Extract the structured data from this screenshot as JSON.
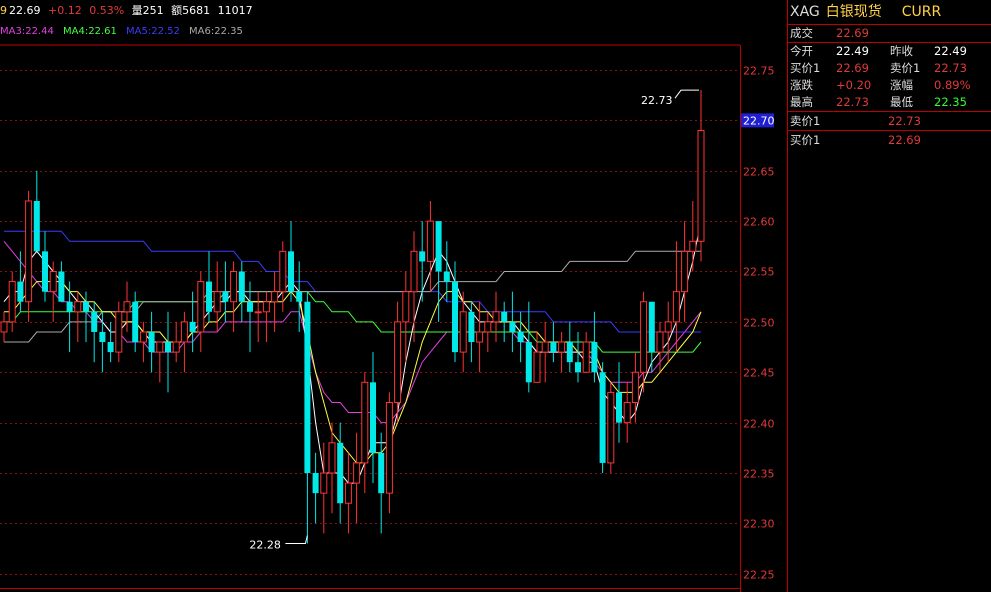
{
  "header": {
    "last_prefix": "9",
    "last_price": "22.69",
    "change": "+0.12",
    "change_pct": "0.53%",
    "volume_label": "量251",
    "amount_label": "额5681",
    "time": "11017"
  },
  "ma_legend": [
    {
      "label": "MA3:22.44",
      "color": "#e040e0"
    },
    {
      "label": "MA4:22.61",
      "color": "#40ff40"
    },
    {
      "label": "MA5:22.52",
      "color": "#3a3aff"
    },
    {
      "label": "MA6:22.35",
      "color": "#aaaaaa"
    }
  ],
  "panel": {
    "code": "XAG",
    "name": "白银现货",
    "currency": "CURR",
    "rows": [
      {
        "label": "成交",
        "value": "22.69",
        "color": "#e03a3a"
      },
      {
        "label": "今开",
        "value": "22.49",
        "color": "#ffffff",
        "label2": "昨收",
        "value2": "22.49",
        "color2": "#ffffff"
      },
      {
        "label": "买价1",
        "value": "22.69",
        "color": "#e03a3a",
        "label2": "卖价1",
        "value2": "22.73",
        "color2": "#e03a3a"
      },
      {
        "label": "涨跌",
        "value": "+0.20",
        "color": "#e03a3a",
        "label2": "涨幅",
        "value2": "0.89%",
        "color2": "#e03a3a"
      },
      {
        "label": "最高",
        "value": "22.73",
        "color": "#e03a3a",
        "label2": "最低",
        "value2": "22.35",
        "color2": "#30ff30"
      }
    ],
    "ask": {
      "label": "卖价1",
      "value": "22.73"
    },
    "bid": {
      "label": "买价1",
      "value": "22.69"
    }
  },
  "chart_data": {
    "type": "candlestick",
    "y_ticks": [
      "22.75",
      "22.70",
      "22.65",
      "22.60",
      "22.55",
      "22.50",
      "22.45",
      "22.40",
      "22.35",
      "22.30",
      "22.25"
    ],
    "ylim": [
      22.23,
      22.79
    ],
    "current_price_label": "22.70",
    "current_price": 22.7,
    "high_annotation": {
      "label": "22.73",
      "value": 22.73,
      "candle_index": 85
    },
    "low_annotation": {
      "label": "22.28",
      "value": 22.28,
      "candle_index": 37
    },
    "colors": {
      "up": "#ff3333",
      "down": "#00e8e8",
      "grid": "#8a1010",
      "axis": "#c00000"
    },
    "ohlc": [
      [
        22.49,
        22.51,
        22.48,
        22.5
      ],
      [
        22.5,
        22.55,
        22.49,
        22.54
      ],
      [
        22.54,
        22.57,
        22.51,
        22.52
      ],
      [
        22.52,
        22.63,
        22.5,
        22.62
      ],
      [
        22.62,
        22.65,
        22.58,
        22.57
      ],
      [
        22.57,
        22.59,
        22.52,
        22.53
      ],
      [
        22.53,
        22.56,
        22.5,
        22.55
      ],
      [
        22.55,
        22.56,
        22.52,
        22.52
      ],
      [
        22.52,
        22.54,
        22.47,
        22.51
      ],
      [
        22.51,
        22.53,
        22.48,
        22.52
      ],
      [
        22.52,
        22.53,
        22.48,
        22.51
      ],
      [
        22.51,
        22.52,
        22.46,
        22.49
      ],
      [
        22.49,
        22.51,
        22.45,
        22.48
      ],
      [
        22.48,
        22.5,
        22.46,
        22.47
      ],
      [
        22.47,
        22.52,
        22.46,
        22.51
      ],
      [
        22.51,
        22.54,
        22.49,
        22.52
      ],
      [
        22.52,
        22.53,
        22.47,
        22.48
      ],
      [
        22.48,
        22.5,
        22.46,
        22.49
      ],
      [
        22.49,
        22.51,
        22.45,
        22.47
      ],
      [
        22.47,
        22.48,
        22.44,
        22.48
      ],
      [
        22.48,
        22.51,
        22.43,
        22.47
      ],
      [
        22.47,
        22.5,
        22.46,
        22.48
      ],
      [
        22.48,
        22.51,
        22.45,
        22.5
      ],
      [
        22.5,
        22.53,
        22.47,
        22.49
      ],
      [
        22.49,
        22.55,
        22.47,
        22.54
      ],
      [
        22.54,
        22.57,
        22.5,
        22.51
      ],
      [
        22.51,
        22.56,
        22.49,
        22.53
      ],
      [
        22.53,
        22.56,
        22.5,
        22.52
      ],
      [
        22.52,
        22.56,
        22.49,
        22.55
      ],
      [
        22.55,
        22.56,
        22.5,
        22.52
      ],
      [
        22.52,
        22.54,
        22.47,
        22.51
      ],
      [
        22.51,
        22.53,
        22.48,
        22.51
      ],
      [
        22.51,
        22.53,
        22.48,
        22.52
      ],
      [
        22.52,
        22.55,
        22.49,
        22.53
      ],
      [
        22.53,
        22.58,
        22.51,
        22.57
      ],
      [
        22.57,
        22.6,
        22.52,
        22.53
      ],
      [
        22.53,
        22.56,
        22.49,
        22.52
      ],
      [
        22.52,
        22.53,
        22.28,
        22.35
      ],
      [
        22.35,
        22.37,
        22.3,
        22.33
      ],
      [
        22.33,
        22.38,
        22.29,
        22.35
      ],
      [
        22.35,
        22.4,
        22.31,
        22.38
      ],
      [
        22.38,
        22.4,
        22.3,
        22.32
      ],
      [
        22.32,
        22.37,
        22.29,
        22.34
      ],
      [
        22.34,
        22.39,
        22.3,
        22.36
      ],
      [
        22.36,
        22.45,
        22.33,
        22.44
      ],
      [
        22.44,
        22.47,
        22.34,
        22.37
      ],
      [
        22.37,
        22.39,
        22.29,
        22.33
      ],
      [
        22.33,
        22.43,
        22.31,
        22.42
      ],
      [
        22.42,
        22.52,
        22.4,
        22.5
      ],
      [
        22.5,
        22.55,
        22.46,
        22.53
      ],
      [
        22.53,
        22.59,
        22.48,
        22.57
      ],
      [
        22.57,
        22.6,
        22.52,
        22.56
      ],
      [
        22.56,
        22.62,
        22.53,
        22.6
      ],
      [
        22.6,
        22.59,
        22.5,
        22.55
      ],
      [
        22.55,
        22.58,
        22.52,
        22.54
      ],
      [
        22.54,
        22.56,
        22.46,
        22.47
      ],
      [
        22.47,
        22.53,
        22.45,
        22.51
      ],
      [
        22.51,
        22.52,
        22.46,
        22.48
      ],
      [
        22.48,
        22.52,
        22.45,
        22.49
      ],
      [
        22.49,
        22.51,
        22.47,
        22.5
      ],
      [
        22.5,
        22.53,
        22.48,
        22.51
      ],
      [
        22.51,
        22.52,
        22.48,
        22.5
      ],
      [
        22.5,
        22.53,
        22.47,
        22.49
      ],
      [
        22.49,
        22.51,
        22.46,
        22.48
      ],
      [
        22.48,
        22.52,
        22.43,
        22.44
      ],
      [
        22.44,
        22.49,
        22.44,
        22.47
      ],
      [
        22.47,
        22.5,
        22.44,
        22.48
      ],
      [
        22.48,
        22.5,
        22.46,
        22.47
      ],
      [
        22.47,
        22.49,
        22.45,
        22.48
      ],
      [
        22.48,
        22.5,
        22.45,
        22.46
      ],
      [
        22.46,
        22.49,
        22.44,
        22.45
      ],
      [
        22.45,
        22.49,
        22.45,
        22.48
      ],
      [
        22.48,
        22.51,
        22.44,
        22.45
      ],
      [
        22.45,
        22.46,
        22.35,
        22.36
      ],
      [
        22.36,
        22.44,
        22.35,
        22.43
      ],
      [
        22.43,
        22.46,
        22.38,
        22.4
      ],
      [
        22.4,
        22.44,
        22.38,
        22.42
      ],
      [
        22.42,
        22.47,
        22.4,
        22.45
      ],
      [
        22.45,
        22.53,
        22.43,
        22.52
      ],
      [
        22.52,
        22.51,
        22.45,
        22.47
      ],
      [
        22.47,
        22.5,
        22.45,
        22.49
      ],
      [
        22.49,
        22.52,
        22.46,
        22.5
      ],
      [
        22.5,
        22.58,
        22.47,
        22.53
      ],
      [
        22.53,
        22.6,
        22.5,
        22.57
      ],
      [
        22.57,
        22.62,
        22.55,
        22.58
      ],
      [
        22.58,
        22.73,
        22.56,
        22.69
      ]
    ],
    "ma_series": [
      {
        "name": "MA3",
        "color": "#e040e0",
        "values": [
          22.58,
          22.57,
          22.56,
          22.55,
          22.54,
          22.53,
          22.53,
          22.52,
          22.52,
          22.51,
          22.51,
          22.5,
          22.5,
          22.49,
          22.49,
          22.48,
          22.48,
          22.48,
          22.47,
          22.47,
          22.47,
          22.47,
          22.48,
          22.48,
          22.49,
          22.49,
          22.49,
          22.5,
          22.5,
          22.5,
          22.5,
          22.5,
          22.5,
          22.5,
          22.5,
          22.51,
          22.51,
          22.48,
          22.45,
          22.43,
          22.42,
          22.42,
          22.41,
          22.41,
          22.41,
          22.41,
          22.4,
          22.4,
          22.41,
          22.42,
          22.44,
          22.46,
          22.47,
          22.48,
          22.49,
          22.49,
          22.49,
          22.49,
          22.49,
          22.49,
          22.49,
          22.49,
          22.49,
          22.48,
          22.48,
          22.47,
          22.47,
          22.47,
          22.47,
          22.47,
          22.47,
          22.47,
          22.46,
          22.45,
          22.44,
          22.44,
          22.44,
          22.44,
          22.45,
          22.45,
          22.46,
          22.47,
          22.48,
          22.49,
          22.5,
          22.51
        ]
      },
      {
        "name": "MA4",
        "color": "#40ff40",
        "values": [
          22.5,
          22.5,
          22.51,
          22.51,
          22.51,
          22.51,
          22.51,
          22.51,
          22.51,
          22.51,
          22.51,
          22.51,
          22.51,
          22.51,
          22.51,
          22.51,
          22.52,
          22.52,
          22.52,
          22.52,
          22.52,
          22.52,
          22.52,
          22.52,
          22.52,
          22.52,
          22.52,
          22.53,
          22.53,
          22.53,
          22.53,
          22.53,
          22.53,
          22.53,
          22.53,
          22.53,
          22.53,
          22.53,
          22.52,
          22.52,
          22.51,
          22.51,
          22.51,
          22.5,
          22.5,
          22.5,
          22.49,
          22.49,
          22.49,
          22.49,
          22.49,
          22.49,
          22.49,
          22.49,
          22.49,
          22.49,
          22.49,
          22.49,
          22.49,
          22.49,
          22.49,
          22.49,
          22.49,
          22.49,
          22.49,
          22.48,
          22.48,
          22.48,
          22.48,
          22.48,
          22.48,
          22.48,
          22.48,
          22.47,
          22.47,
          22.47,
          22.47,
          22.47,
          22.47,
          22.47,
          22.47,
          22.47,
          22.47,
          22.47,
          22.47,
          22.48
        ]
      },
      {
        "name": "MA5",
        "color": "#3a3aff",
        "values": [
          22.59,
          22.59,
          22.59,
          22.59,
          22.59,
          22.59,
          22.59,
          22.59,
          22.58,
          22.58,
          22.58,
          22.58,
          22.58,
          22.58,
          22.58,
          22.58,
          22.58,
          22.58,
          22.57,
          22.57,
          22.57,
          22.57,
          22.57,
          22.57,
          22.57,
          22.57,
          22.57,
          22.57,
          22.57,
          22.56,
          22.56,
          22.56,
          22.55,
          22.55,
          22.55,
          22.54,
          22.54,
          22.54,
          22.53,
          22.53,
          22.53,
          22.53,
          22.53,
          22.53,
          22.53,
          22.53,
          22.53,
          22.53,
          22.53,
          22.53,
          22.53,
          22.53,
          22.53,
          22.53,
          22.52,
          22.52,
          22.52,
          22.52,
          22.52,
          22.51,
          22.51,
          22.51,
          22.51,
          22.51,
          22.51,
          22.51,
          22.51,
          22.5,
          22.5,
          22.5,
          22.5,
          22.5,
          22.5,
          22.5,
          22.5,
          22.49,
          22.49,
          22.49,
          22.49,
          22.49,
          22.49,
          22.49,
          22.49,
          22.49,
          22.49,
          22.49
        ]
      },
      {
        "name": "MA6",
        "color": "#aaaaaa",
        "values": [
          22.48,
          22.48,
          22.48,
          22.48,
          22.49,
          22.49,
          22.49,
          22.49,
          22.5,
          22.5,
          22.5,
          22.5,
          22.51,
          22.51,
          22.51,
          22.51,
          22.51,
          22.52,
          22.52,
          22.52,
          22.52,
          22.52,
          22.52,
          22.52,
          22.52,
          22.53,
          22.53,
          22.53,
          22.53,
          22.53,
          22.53,
          22.53,
          22.53,
          22.53,
          22.53,
          22.53,
          22.53,
          22.53,
          22.53,
          22.53,
          22.53,
          22.53,
          22.53,
          22.53,
          22.53,
          22.53,
          22.53,
          22.53,
          22.53,
          22.53,
          22.53,
          22.53,
          22.53,
          22.54,
          22.54,
          22.54,
          22.54,
          22.54,
          22.54,
          22.54,
          22.54,
          22.55,
          22.55,
          22.55,
          22.55,
          22.55,
          22.55,
          22.55,
          22.55,
          22.56,
          22.56,
          22.56,
          22.56,
          22.56,
          22.56,
          22.56,
          22.56,
          22.57,
          22.57,
          22.57,
          22.57,
          22.57,
          22.57,
          22.57,
          22.57,
          22.57
        ]
      },
      {
        "name": "white",
        "color": "#ffffff",
        "values": [
          22.52,
          22.53,
          22.53,
          22.56,
          22.57,
          22.56,
          22.55,
          22.54,
          22.53,
          22.52,
          22.52,
          22.51,
          22.5,
          22.49,
          22.49,
          22.5,
          22.5,
          22.49,
          22.48,
          22.48,
          22.48,
          22.48,
          22.48,
          22.49,
          22.5,
          22.51,
          22.52,
          22.52,
          22.53,
          22.53,
          22.52,
          22.52,
          22.52,
          22.52,
          22.53,
          22.54,
          22.53,
          22.47,
          22.4,
          22.35,
          22.35,
          22.35,
          22.34,
          22.34,
          22.36,
          22.38,
          22.38,
          22.38,
          22.41,
          22.46,
          22.5,
          22.53,
          22.55,
          22.57,
          22.56,
          22.54,
          22.52,
          22.51,
          22.5,
          22.5,
          22.5,
          22.5,
          22.5,
          22.49,
          22.48,
          22.47,
          22.47,
          22.47,
          22.47,
          22.47,
          22.47,
          22.46,
          22.46,
          22.43,
          22.42,
          22.41,
          22.4,
          22.41,
          22.44,
          22.46,
          22.47,
          22.48,
          22.5,
          22.53,
          22.56,
          22.6
        ]
      },
      {
        "name": "yellow",
        "color": "#ffff40",
        "values": [
          22.51,
          22.51,
          22.52,
          22.53,
          22.54,
          22.54,
          22.54,
          22.54,
          22.53,
          22.53,
          22.52,
          22.52,
          22.51,
          22.51,
          22.5,
          22.5,
          22.5,
          22.49,
          22.49,
          22.49,
          22.48,
          22.48,
          22.48,
          22.49,
          22.49,
          22.5,
          22.5,
          22.51,
          22.51,
          22.52,
          22.52,
          22.52,
          22.52,
          22.52,
          22.52,
          22.53,
          22.52,
          22.49,
          22.45,
          22.42,
          22.39,
          22.38,
          22.37,
          22.36,
          22.36,
          22.37,
          22.37,
          22.38,
          22.4,
          22.42,
          22.45,
          22.48,
          22.5,
          22.52,
          22.53,
          22.53,
          22.52,
          22.52,
          22.51,
          22.51,
          22.5,
          22.5,
          22.5,
          22.5,
          22.49,
          22.49,
          22.48,
          22.48,
          22.48,
          22.48,
          22.47,
          22.47,
          22.47,
          22.45,
          22.44,
          22.43,
          22.43,
          22.43,
          22.44,
          22.44,
          22.45,
          22.46,
          22.47,
          22.48,
          22.49,
          22.51
        ]
      }
    ]
  }
}
